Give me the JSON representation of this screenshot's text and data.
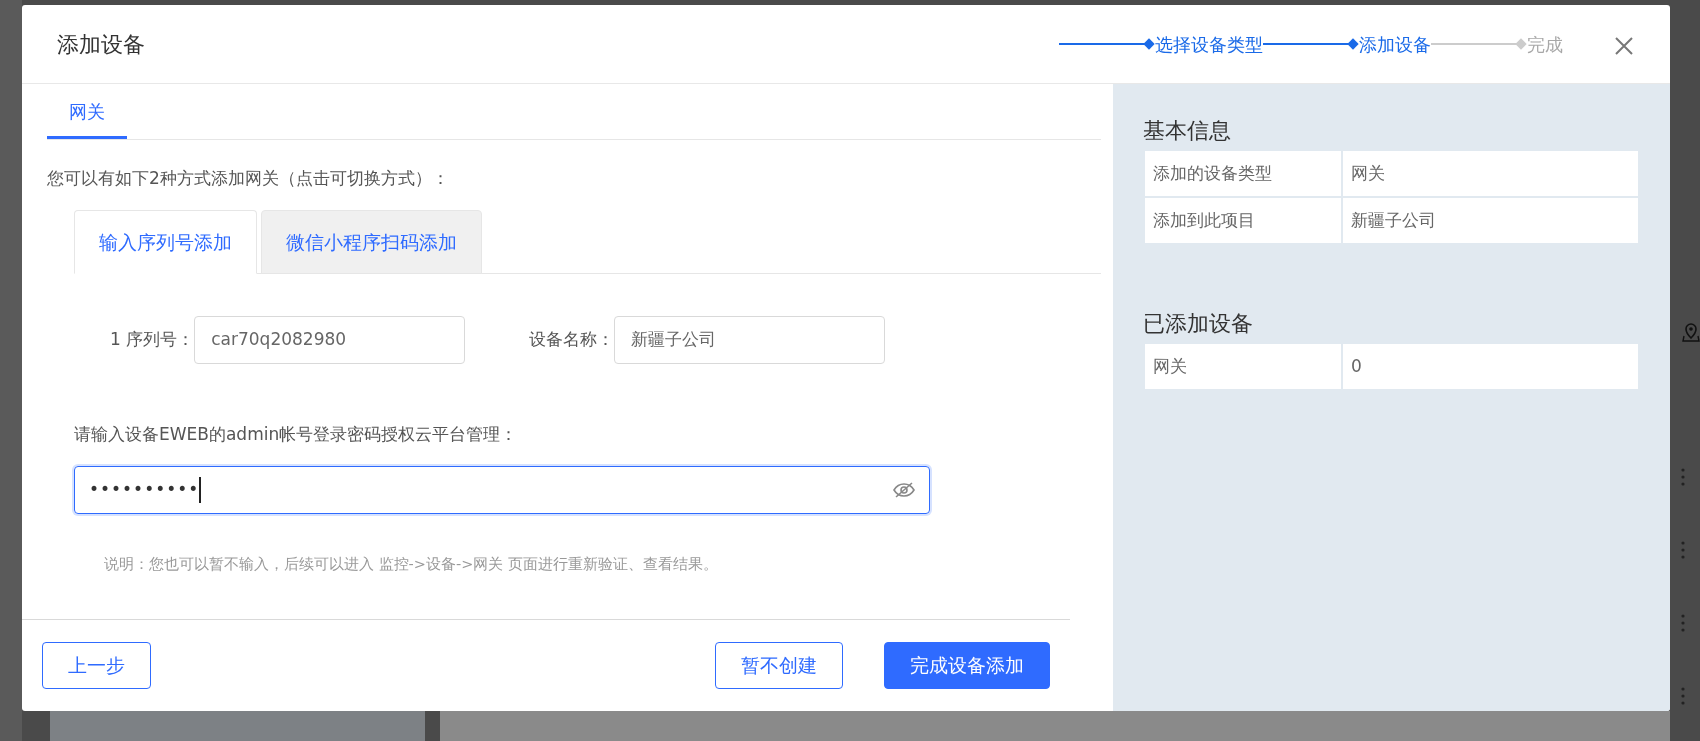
{
  "window": {
    "title": "添加设备"
  },
  "steps": [
    {
      "label": "选择设备类型",
      "reached": true
    },
    {
      "label": "添加设备",
      "reached": true
    },
    {
      "label": "完成",
      "reached": false
    }
  ],
  "device_tabs": [
    {
      "label": "网关",
      "selected": true
    }
  ],
  "intro": "您可以有如下2种方式添加网关（点击可切换方式）：",
  "method_tabs": [
    {
      "label": "输入序列号添加",
      "selected": true
    },
    {
      "label": "微信小程序扫码添加",
      "selected": false
    }
  ],
  "fields": [
    {
      "label": "1 序列号：",
      "value": "car70q2082980"
    },
    {
      "label": "设备名称：",
      "value": "新疆子公司"
    }
  ],
  "password": {
    "label": "请输入设备EWEB的admin帐号登录密码授权云平台管理：",
    "value": "••••••••••",
    "focused": true,
    "show_password": false
  },
  "note": "说明：您也可以暂不输入，后续可以进入 监控->设备->网关 页面进行重新验证、查看结果。",
  "buttons": [
    {
      "label": "上一步",
      "kind": "outline"
    },
    {
      "label": "暂不创建",
      "kind": "outline"
    },
    {
      "label": "完成设备添加",
      "kind": "primary"
    }
  ],
  "sidebar": [
    {
      "title": "基本信息",
      "rows": [
        [
          "添加的设备类型",
          "网关"
        ],
        [
          "添加到此项目",
          "新疆子公司"
        ]
      ]
    },
    {
      "title": "已添加设备",
      "rows": [
        [
          "网关",
          "0"
        ]
      ]
    }
  ]
}
